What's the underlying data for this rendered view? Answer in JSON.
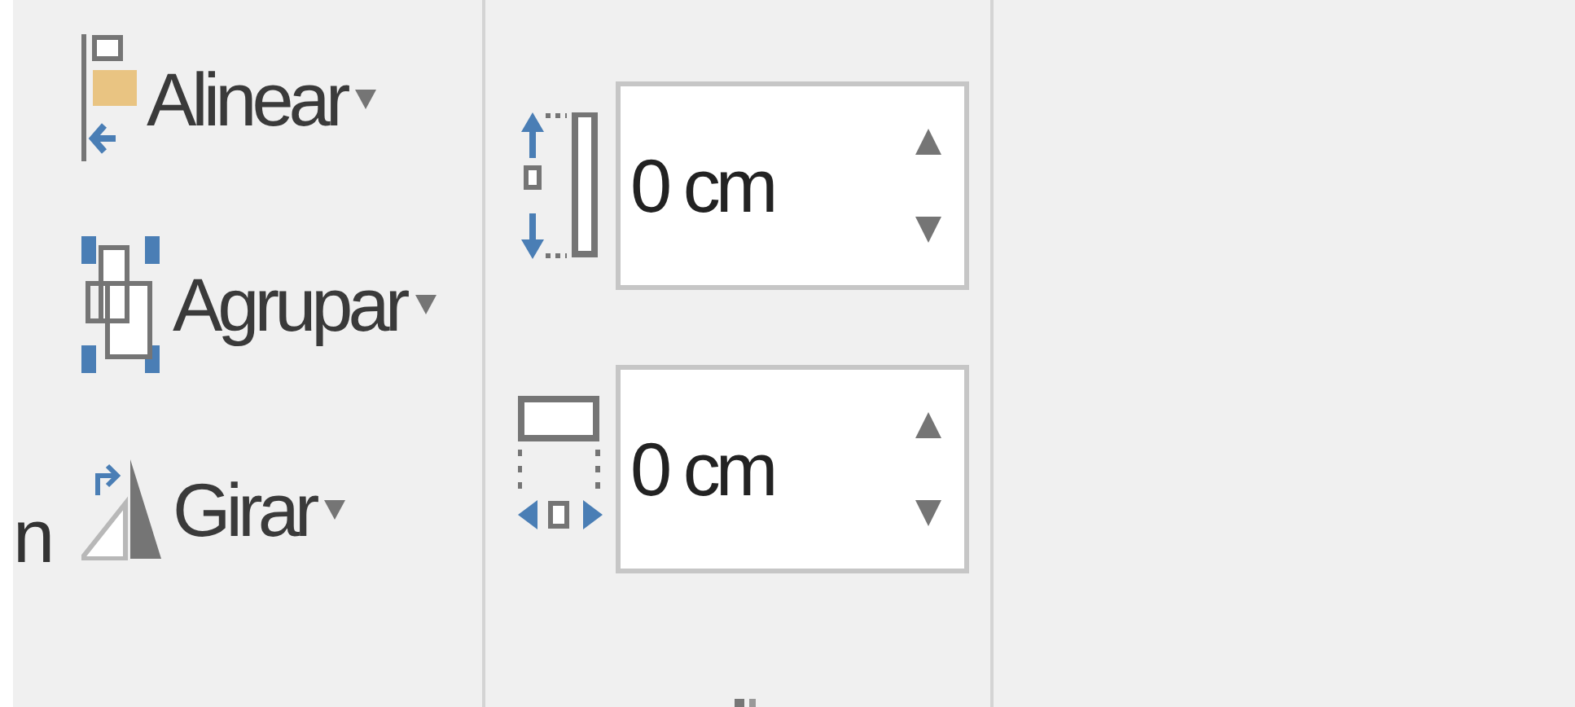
{
  "left_fragment": "n",
  "commands": [
    {
      "kind": "align",
      "label": "Alinear"
    },
    {
      "kind": "group",
      "label": "Agrupar"
    },
    {
      "kind": "rotate",
      "label": "Girar"
    }
  ],
  "size_fields": [
    {
      "kind": "height",
      "value": "0 cm"
    },
    {
      "kind": "width",
      "value": "0 cm"
    }
  ]
}
